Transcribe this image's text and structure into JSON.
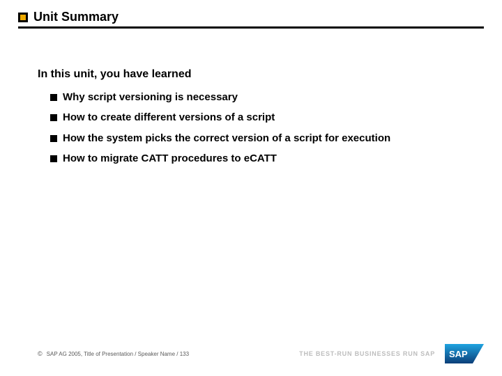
{
  "title": "Unit Summary",
  "intro": "In this unit, you have learned",
  "bullets": [
    "Why script versioning is necessary",
    "How to create different versions of a script",
    "How the system picks the correct version of a script for execution",
    "How to migrate CATT procedures to eCATT"
  ],
  "footer": {
    "copy_symbol": "©",
    "copyright": "SAP AG 2005, Title of Presentation / Speaker Name / 133",
    "tagline": "THE BEST-RUN BUSINESSES RUN SAP"
  }
}
